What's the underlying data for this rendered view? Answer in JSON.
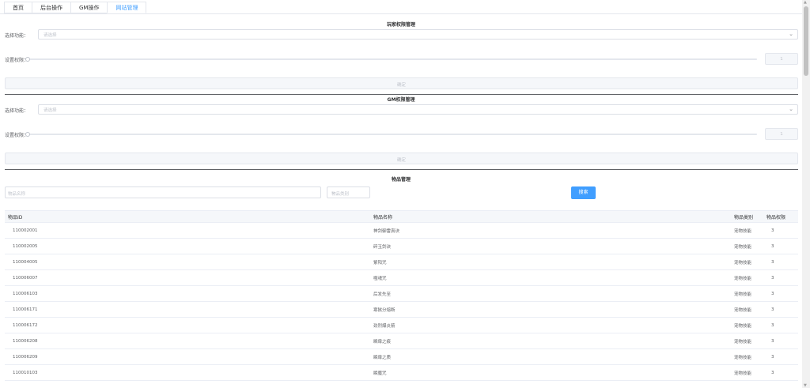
{
  "tabs": [
    "首页",
    "后台操作",
    "GM操作",
    "网站管理"
  ],
  "active_tab": 3,
  "player_section": {
    "title": "玩家权限管理",
    "function_label": "选择功能：",
    "function_placeholder": "请选择",
    "permission_label": "设置权限：",
    "permission_value": "1",
    "confirm_label": "确定"
  },
  "gm_section": {
    "title": "GM权限管理",
    "function_label": "选择功能：",
    "function_placeholder": "请选择",
    "permission_label": "设置权限：",
    "permission_value": "1",
    "confirm_label": "确定"
  },
  "item_section": {
    "title": "物品管理",
    "name_placeholder": "物品名称",
    "type_placeholder": "物品类别",
    "search_label": "搜索",
    "columns": [
      "物品ID",
      "物品名称",
      "物品类别",
      "物品权限"
    ],
    "rows": [
      [
        "110002001",
        "神剑御雷真诀",
        "宠物技能",
        "3"
      ],
      [
        "110002005",
        "碎玉剑诀",
        "宠物技能",
        "3"
      ],
      [
        "110004005",
        "紫阳咒",
        "宠物技能",
        "3"
      ],
      [
        "110006007",
        "噬魂咒",
        "宠物技能",
        "3"
      ],
      [
        "110006103",
        "后发先至",
        "宠物技能",
        "3"
      ],
      [
        "110006171",
        "寒獄分熔断",
        "宠物技能",
        "3"
      ],
      [
        "110006172",
        "劲烈爆炎箭",
        "宠物技能",
        "3"
      ],
      [
        "110006208",
        "瞬扉之痕",
        "宠物技能",
        "3"
      ],
      [
        "110006209",
        "瞬扉之质",
        "宠物技能",
        "3"
      ],
      [
        "110010103",
        "瞬魔咒",
        "宠物技能",
        "3"
      ]
    ]
  },
  "colors": {
    "accent": "#409eff",
    "border": "#dcdfe6",
    "muted": "#c0c4cc"
  },
  "icons": {
    "select_arrow": "chevron-down-icon",
    "slider_handle": "slider-handle-icon"
  }
}
